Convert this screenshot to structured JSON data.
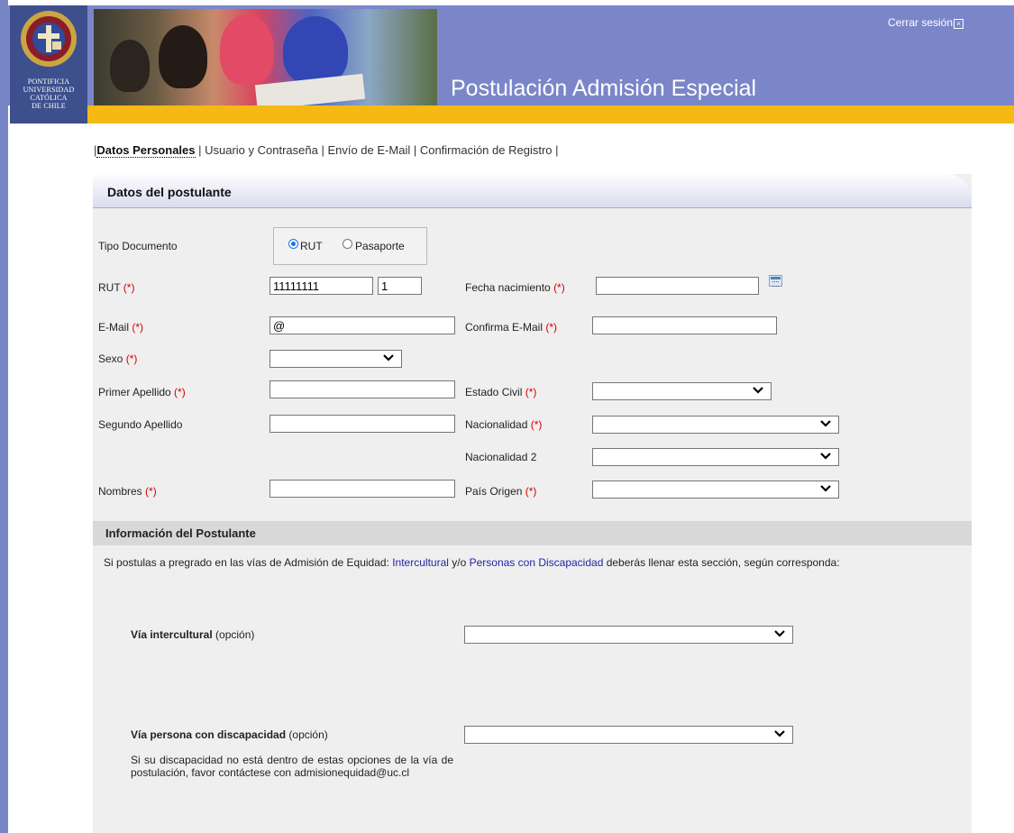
{
  "header": {
    "university_lines": [
      "Pontificia",
      "Universidad",
      "Católica",
      "de Chile"
    ],
    "page_title": "Postulación Admisión Especial",
    "logout_label": "Cerrar sesión",
    "logout_icon_glyph": "×"
  },
  "steps": {
    "items": [
      "Datos Personales",
      "Usuario y Contraseña",
      "Envío de E-Mail",
      "Confirmación de Registro"
    ],
    "separator": " | ",
    "active_index": 0
  },
  "form": {
    "panel_title": "Datos del postulante",
    "required_mark": "(*)",
    "tipo_documento": {
      "label": "Tipo Documento",
      "options": [
        "RUT",
        "Pasaporte"
      ],
      "selected": "RUT"
    },
    "rut": {
      "label": "RUT",
      "number_value": "11111111",
      "check_digit_value": "1"
    },
    "fecha_nacimiento": {
      "label": "Fecha nacimiento",
      "value": ""
    },
    "email": {
      "label": "E-Mail",
      "value": "@"
    },
    "confirma_email": {
      "label": "Confirma E-Mail",
      "value": ""
    },
    "sexo": {
      "label": "Sexo",
      "selected": ""
    },
    "primer_apellido": {
      "label": "Primer Apellido",
      "value": ""
    },
    "estado_civil": {
      "label": "Estado Civil",
      "selected": ""
    },
    "segundo_apellido": {
      "label": "Segundo Apellido",
      "value": ""
    },
    "nacionalidad": {
      "label": "Nacionalidad",
      "selected": ""
    },
    "nacionalidad2": {
      "label": "Nacionalidad 2",
      "selected": ""
    },
    "nombres": {
      "label": "Nombres",
      "value": ""
    },
    "pais_origen": {
      "label": "País Origen",
      "selected": ""
    }
  },
  "info": {
    "section_title": "Información del Postulante",
    "intro_before": "Si postulas a pregrado en las vías de Admisión de Equidad: ",
    "link1": "Intercultural",
    "intro_mid": " y/o ",
    "link2": "Personas con Discapacidad",
    "intro_after": " deberás llenar esta sección, según corresponda:",
    "via_intercultural_label": "Vía intercultural",
    "via_intercultural_suffix": " (opción)",
    "via_intercultural_selected": "",
    "via_discapacidad_label": "Vía persona con discapacidad",
    "via_discapacidad_suffix": " (opción)",
    "via_discapacidad_selected": "",
    "note": "Si su discapacidad no está dentro de estas opciones de la vía de postulación, favor contáctese con admisionequidad@uc.cl"
  },
  "colors": {
    "header_blue": "#7b86c9",
    "crest_blue": "#3e4f8e",
    "gold": "#f5b913",
    "panel_gray": "#efefef",
    "required_red": "#d40000",
    "link_blue": "#2525a8"
  }
}
